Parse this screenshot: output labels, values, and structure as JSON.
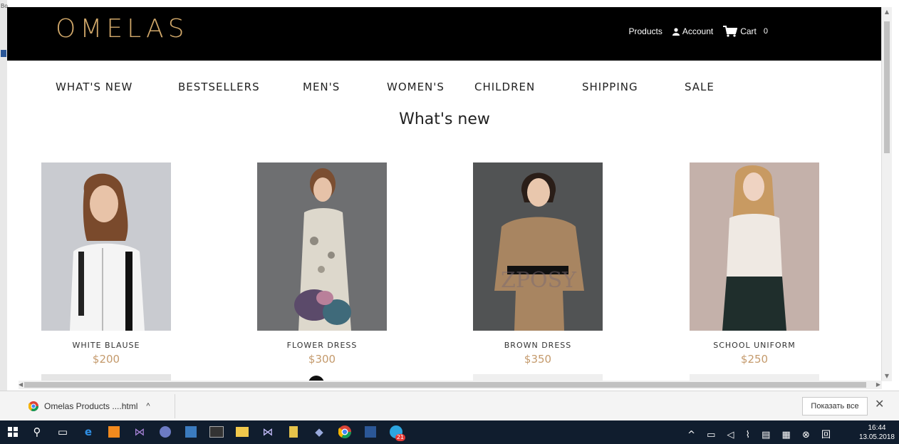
{
  "browser": {
    "left_gutter": {
      "top_text": "Bo",
      "bottom_text": "Ct"
    }
  },
  "site": {
    "logo": "OMELAS",
    "top_links": {
      "products": "Products",
      "account": "Account",
      "cart": "Cart",
      "cart_count": "0"
    },
    "nav": [
      "WHAT'S NEW",
      "BESTSELLERS",
      "MEN'S",
      "WOMEN'S",
      "CHILDREN",
      "SHIPPING",
      "SALE"
    ],
    "section_title": "What's new",
    "products": [
      {
        "name": "WHITE BLAUSE",
        "price": "$200"
      },
      {
        "name": "FLOWER DRESS",
        "price": "$300"
      },
      {
        "name": "BROWN DRESS",
        "price": "$350"
      },
      {
        "name": "SCHOOL UNIFORM",
        "price": "$250"
      }
    ]
  },
  "download_bar": {
    "file": "Omelas Products ....html",
    "show_all": "Показать все"
  },
  "taskbar": {
    "time": "16:44",
    "date": "13.05.2018",
    "badge_count": "21"
  },
  "colors": {
    "accent_gold": "#c49a6c",
    "logo_gold": "#d1a86a",
    "topbar": "#000000",
    "taskbar": "#101d2e"
  }
}
